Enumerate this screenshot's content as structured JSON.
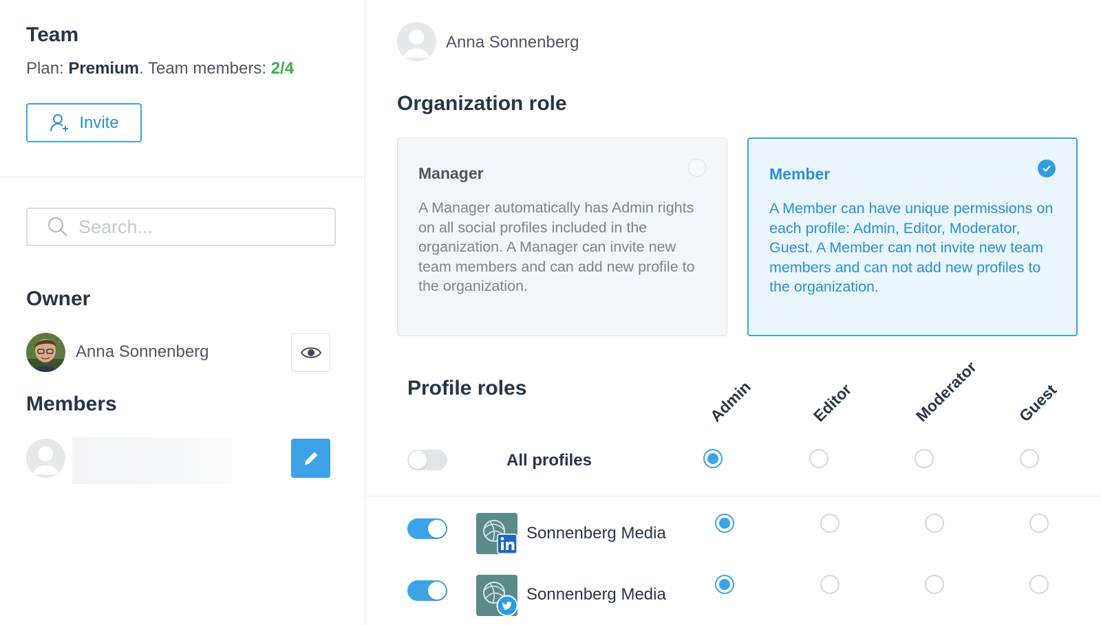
{
  "left_panel": {
    "team_title": "Team",
    "plan_label": "Plan:",
    "plan_name": "Premium",
    "members_label": ". Team members:",
    "members_count": "2/4",
    "invite_label": "Invite",
    "search_placeholder": "Search...",
    "owner_title": "Owner",
    "owner_name": "Anna Sonnenberg",
    "members_title": "Members"
  },
  "right_panel": {
    "user_name": "Anna Sonnenberg",
    "org_role_title": "Organization role",
    "roles": [
      {
        "title": "Manager",
        "description": "A Manager automatically has Admin rights on all social profiles included in the organization. A Manager can invite new team members and can add new profile to the organization.",
        "selected": false
      },
      {
        "title": "Member",
        "description": "A Member can have unique permissions on each profile: Admin, Editor, Moderator, Guest. A Member can not invite new team members and can not add new profiles to the organization.",
        "selected": true
      }
    ],
    "profile_roles_title": "Profile roles",
    "columns": [
      "Admin",
      "Editor",
      "Moderator",
      "Guest"
    ],
    "all_profiles": {
      "label": "All profiles",
      "enabled": false,
      "selected_role": "Admin"
    },
    "profiles": [
      {
        "name": "Sonnenberg Media",
        "network": "linkedin",
        "badge_text": "in",
        "enabled": true,
        "selected_role": "Admin"
      },
      {
        "name": "Sonnenberg Media",
        "network": "twitter",
        "enabled": true,
        "selected_role": "Admin"
      }
    ]
  },
  "colors": {
    "accent": "#3ea3e6",
    "success": "#3cae4f",
    "text_dark": "#263648",
    "text_muted": "#7a848e"
  },
  "icons": {
    "invite": "add-user-icon",
    "search": "search-icon",
    "view": "eye-icon",
    "edit": "pencil-icon",
    "selected_role": "check-icon"
  }
}
